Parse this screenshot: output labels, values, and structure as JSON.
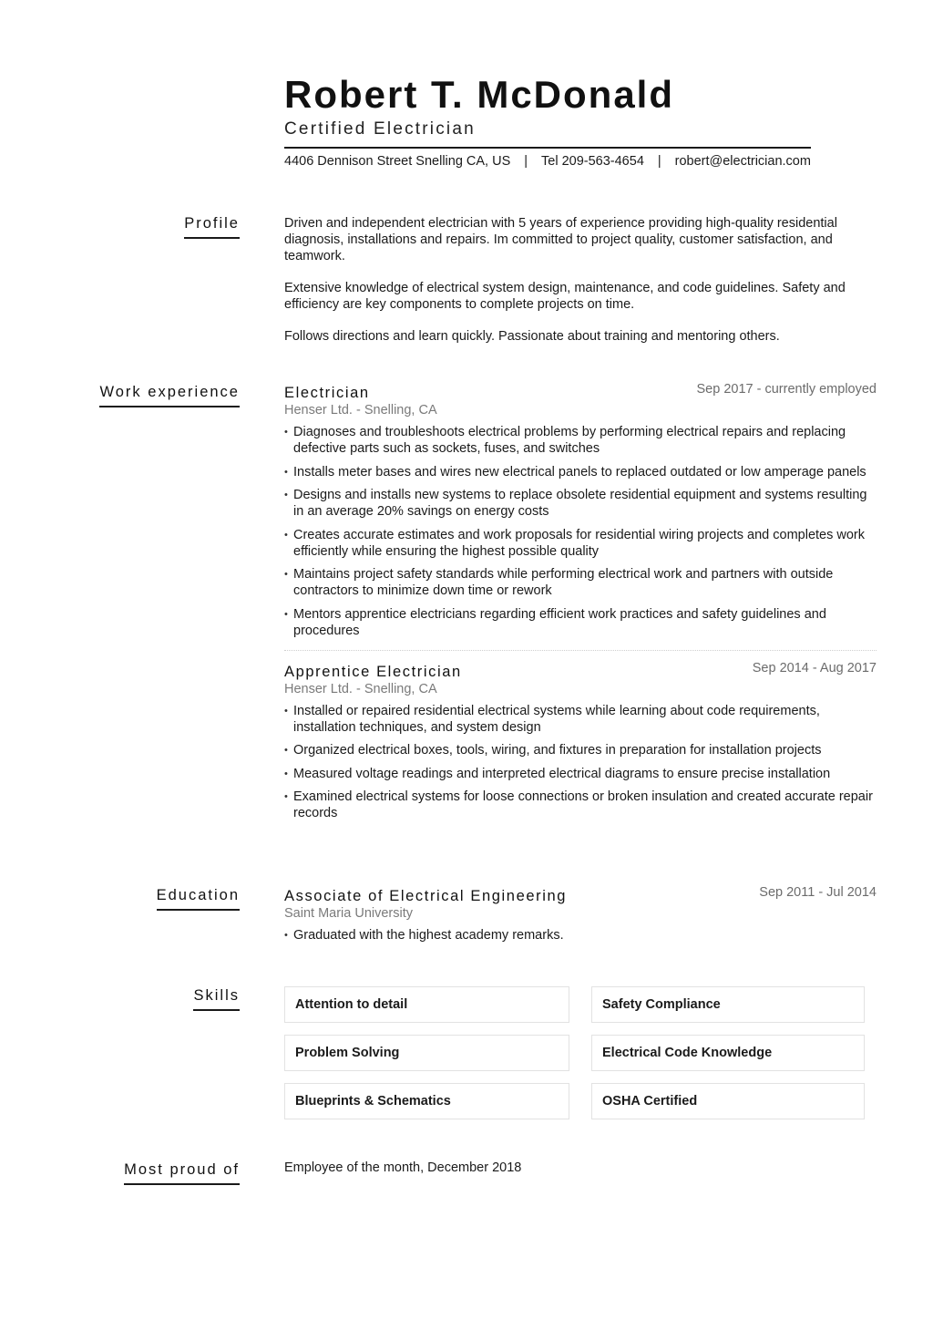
{
  "header": {
    "name": "Robert T. McDonald",
    "title": "Certified Electrician",
    "address": "4406 Dennison Street Snelling CA, US",
    "phone": "Tel 209-563-4654",
    "email": "robert@electrician.com",
    "separator": "|"
  },
  "profile": {
    "label": "Profile",
    "paragraphs": [
      "Driven and independent electrician with 5 years of experience providing high-quality residential diagnosis, installations and repairs. Im committed to project quality, customer satisfaction, and teamwork.",
      "Extensive knowledge of electrical system design, maintenance, and code guidelines. Safety and efficiency are key components to complete projects on time.",
      "Follows directions and learn quickly. Passionate about training and mentoring others."
    ]
  },
  "work": {
    "label": "Work experience",
    "jobs": [
      {
        "title": "Electrician",
        "dates": "Sep 2017 - currently employed",
        "org": "Henser Ltd. - Snelling, CA",
        "bullets": [
          "Diagnoses and troubleshoots electrical problems by performing electrical repairs and replacing defective parts such as sockets, fuses, and switches",
          "Installs meter bases and wires new electrical panels to replaced outdated or low amperage panels",
          "Designs and installs new systems to replace obsolete residential equipment and systems resulting in an average 20% savings on energy costs",
          "Creates accurate estimates and work proposals for residential wiring projects and completes work efficiently while ensuring the highest possible quality",
          "Maintains project safety standards while performing electrical work and partners with outside contractors to minimize down time or rework",
          "Mentors apprentice electricians regarding efficient work practices and safety guidelines and procedures"
        ]
      },
      {
        "title": "Apprentice Electrician",
        "dates": "Sep 2014 - Aug 2017",
        "org": "Henser Ltd. - Snelling, CA",
        "bullets": [
          "Installed or repaired residential electrical systems while learning about code requirements, installation techniques, and system design",
          "Organized electrical boxes, tools, wiring, and fixtures in preparation for installation projects",
          "Measured voltage readings and interpreted electrical diagrams to ensure precise installation",
          "Examined electrical systems for loose connections or broken insulation and created accurate repair records"
        ]
      }
    ]
  },
  "education": {
    "label": "Education",
    "degree": "Associate of Electrical Engineering",
    "dates": "Sep 2011 - Jul 2014",
    "school": "Saint Maria University",
    "bullets": [
      "Graduated with the highest academy remarks."
    ]
  },
  "skills": {
    "label": "Skills",
    "items": [
      "Attention to detail",
      "Safety Compliance",
      "Problem Solving",
      "Electrical Code Knowledge",
      "Blueprints & Schematics",
      "OSHA Certified"
    ]
  },
  "proud": {
    "label": "Most proud of",
    "text": "Employee of the month, December 2018"
  }
}
